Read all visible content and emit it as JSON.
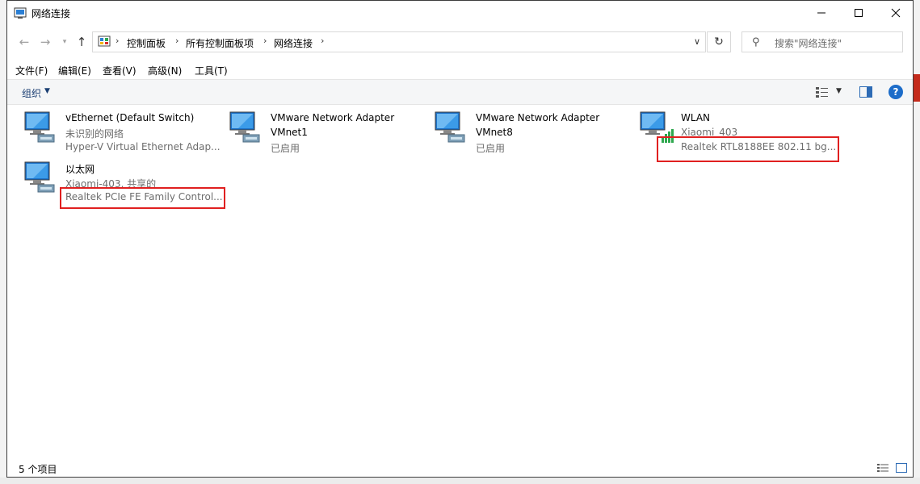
{
  "window": {
    "title": "网络连接"
  },
  "nav": {
    "breadcrumb": [
      "控制面板",
      "所有控制面板项",
      "网络连接"
    ],
    "search_placeholder": "搜索\"网络连接\""
  },
  "menu": [
    "文件(F)",
    "编辑(E)",
    "查看(V)",
    "高级(N)",
    "工具(T)"
  ],
  "toolbar": {
    "organize_label": "组织"
  },
  "connections": [
    {
      "name": "vEthernet (Default Switch)",
      "status": "未识别的网络",
      "device": "Hyper-V Virtual Ethernet Adap...",
      "type": "ethernet"
    },
    {
      "name": "VMware Network Adapter",
      "status": "VMnet1",
      "device": "已启用",
      "type": "ethernet"
    },
    {
      "name": "VMware Network Adapter",
      "status": "VMnet8",
      "device": "已启用",
      "type": "ethernet"
    },
    {
      "name": "WLAN",
      "status": "Xiaomi_403",
      "device": "Realtek RTL8188EE 802.11 bg...",
      "type": "wifi"
    },
    {
      "name": "以太网",
      "status": "Xiaomi-403, 共享的",
      "device": "Realtek PCIe FE Family Control...",
      "type": "ethernet"
    }
  ],
  "status": {
    "item_count": "5 个项目"
  },
  "colors": {
    "highlight_box": "#e02020",
    "accent": "#1c6cc9"
  }
}
